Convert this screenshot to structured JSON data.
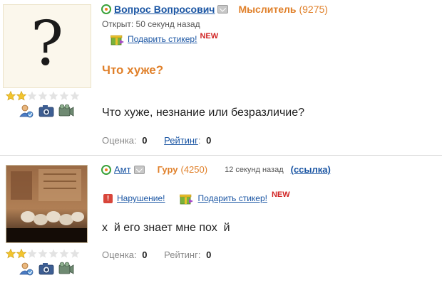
{
  "post1": {
    "author": "Вопрос Вопросович",
    "rank": "Мыслитель",
    "points": "(9275)",
    "opened": "Открыт: 50 секунд назад",
    "gift_label": "Подарить стикер!",
    "new_badge": "NEW",
    "title": "Что хуже?",
    "body": "Что хуже, незнание или безразличие?",
    "score_label": "Оценка:",
    "score_value": "0",
    "rating_label": "Рейтинг",
    "rating_sep": ":",
    "rating_value": "0",
    "avatar_glyph": "?"
  },
  "post2": {
    "author": "Амт",
    "rank": "Гуру",
    "points": "(4250)",
    "time": "12 секунд назад",
    "link_label": "(ссылка)",
    "violation_label": "Нарушение!",
    "gift_label": "Подарить стикер!",
    "new_badge": "NEW",
    "body": "х  й его знает мне пох  й",
    "score_label": "Оценка:",
    "score_value": "0",
    "rating_label": "Рейтинг:",
    "rating_value": "0"
  },
  "colors": {
    "link": "#1a55a3",
    "rank": "#e0802a",
    "new_badge": "#d12626",
    "star_on": "#f2c42e",
    "star_off": "#e3e3e3"
  },
  "icons": {
    "user": "user-icon",
    "camera": "camera-icon",
    "video": "video-icon",
    "gift": "gift-icon",
    "mail": "mail-icon",
    "status": "online-status-icon",
    "warning": "warning-icon"
  },
  "rating_stars": {
    "filled": 2,
    "total": 7
  }
}
